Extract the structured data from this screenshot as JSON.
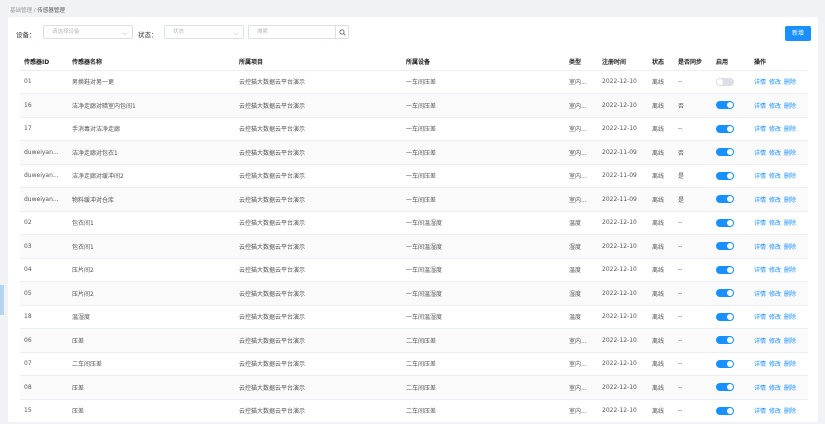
{
  "breadcrumb": {
    "parent": "基础管理",
    "separator": " / ",
    "current": "传感器管理"
  },
  "filters": {
    "device_label": "设备：",
    "device_placeholder": "请选择设备",
    "status_label": "状态：",
    "status_placeholder": "状态",
    "search_placeholder": "搜索"
  },
  "add_button": "新增",
  "columns": [
    "传感器ID",
    "传感器名称",
    "所属项目",
    "所属设备",
    "类型",
    "注册时间",
    "状态",
    "是否同步",
    "启用",
    "操作"
  ],
  "row_actions": {
    "detail": "详情",
    "edit": "修改",
    "delete": "删除"
  },
  "rows": [
    {
      "id": "01",
      "name": "男换鞋对男一更",
      "project": "云控猫大数据云平台演示",
      "device": "一车间压差",
      "type": "室内...",
      "date": "2022-12-10",
      "status": "离线",
      "sync": "--",
      "enabled": false
    },
    {
      "id": "16",
      "name": "洁净走廊对暗室内包间1",
      "project": "云控猫大数据云平台演示",
      "device": "一车间压差",
      "type": "室内...",
      "date": "2022-12-10",
      "status": "离线",
      "sync": "否",
      "enabled": true
    },
    {
      "id": "17",
      "name": "手消毒对洁净走廊",
      "project": "云控猫大数据云平台演示",
      "device": "一车间压差",
      "type": "室内...",
      "date": "2022-12-10",
      "status": "离线",
      "sync": "--",
      "enabled": true
    },
    {
      "id": "duweiyan...",
      "name": "洁净走廊对包衣1",
      "project": "云控猫大数据云平台演示",
      "device": "一车间压差",
      "type": "室内...",
      "date": "2022-11-09",
      "status": "离线",
      "sync": "否",
      "enabled": true
    },
    {
      "id": "duweiyan...",
      "name": "洁净走廊对缓冲间2",
      "project": "云控猫大数据云平台演示",
      "device": "一车间压差",
      "type": "室内...",
      "date": "2022-11-09",
      "status": "离线",
      "sync": "是",
      "enabled": true
    },
    {
      "id": "duweiyan...",
      "name": "物料缓冲对仓库",
      "project": "云控猫大数据云平台演示",
      "device": "一车间压差",
      "type": "室内...",
      "date": "2022-11-09",
      "status": "离线",
      "sync": "是",
      "enabled": true
    },
    {
      "id": "02",
      "name": "包衣间1",
      "project": "云控猫大数据云平台演示",
      "device": "一车间温湿度",
      "type": "温度",
      "date": "2022-12-10",
      "status": "离线",
      "sync": "--",
      "enabled": true
    },
    {
      "id": "03",
      "name": "包衣间1",
      "project": "云控猫大数据云平台演示",
      "device": "一车间温湿度",
      "type": "湿度",
      "date": "2022-12-10",
      "status": "离线",
      "sync": "--",
      "enabled": true
    },
    {
      "id": "04",
      "name": "压片间2",
      "project": "云控猫大数据云平台演示",
      "device": "一车间温湿度",
      "type": "温度",
      "date": "2022-12-10",
      "status": "离线",
      "sync": "--",
      "enabled": true
    },
    {
      "id": "05",
      "name": "压片间2",
      "project": "云控猫大数据云平台演示",
      "device": "一车间温湿度",
      "type": "湿度",
      "date": "2022-12-10",
      "status": "离线",
      "sync": "--",
      "enabled": true
    },
    {
      "id": "18",
      "name": "温湿度",
      "project": "云控猫大数据云平台演示",
      "device": "一车间温湿度",
      "type": "温度",
      "date": "2022-12-10",
      "status": "离线",
      "sync": "--",
      "enabled": true
    },
    {
      "id": "06",
      "name": "压差",
      "project": "云控猫大数据云平台演示",
      "device": "二车间压差",
      "type": "室内...",
      "date": "2022-12-10",
      "status": "离线",
      "sync": "--",
      "enabled": true
    },
    {
      "id": "07",
      "name": "二车间压差",
      "project": "云控猫大数据云平台演示",
      "device": "二车间压差",
      "type": "室内...",
      "date": "2022-12-10",
      "status": "离线",
      "sync": "--",
      "enabled": true
    },
    {
      "id": "08",
      "name": "压差",
      "project": "云控猫大数据云平台演示",
      "device": "二车间压差",
      "type": "室内...",
      "date": "2022-12-10",
      "status": "离线",
      "sync": "--",
      "enabled": true
    },
    {
      "id": "15",
      "name": "压差",
      "project": "云控猫大数据云平台演示",
      "device": "二车间压差",
      "type": "室内...",
      "date": "2022-12-10",
      "status": "离线",
      "sync": "--",
      "enabled": true
    }
  ],
  "colors": {
    "accent": "#1890ff",
    "toggle_off": "#dcdfe6",
    "border": "#ebeef5"
  }
}
